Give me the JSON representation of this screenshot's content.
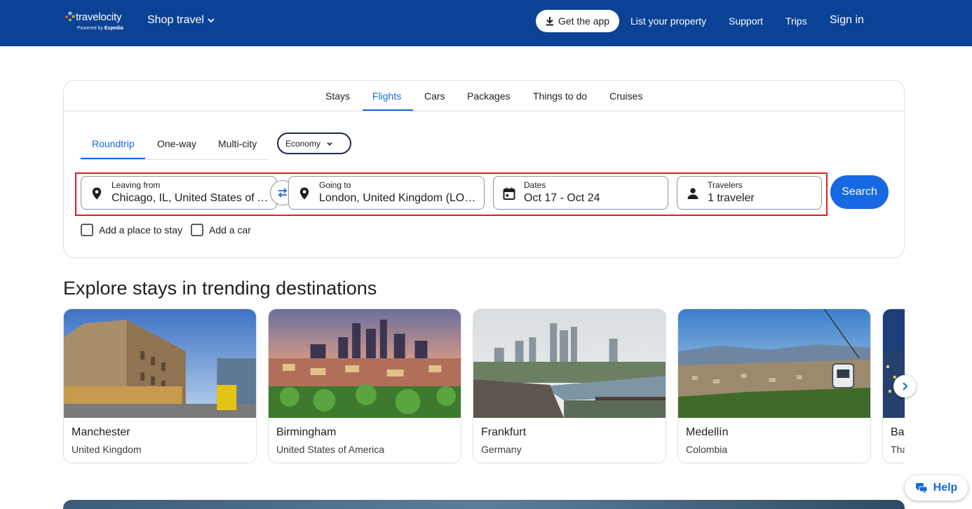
{
  "header": {
    "logo_main": "travelocity",
    "logo_sub_prefix": "Powered by",
    "logo_sub_brand": "Expedia",
    "shop_travel": "Shop travel",
    "get_app": "Get the app",
    "list_property": "List your property",
    "support": "Support",
    "trips": "Trips",
    "sign_in": "Sign in"
  },
  "search": {
    "tabs": [
      {
        "label": "Stays"
      },
      {
        "label": "Flights",
        "active": true
      },
      {
        "label": "Cars"
      },
      {
        "label": "Packages"
      },
      {
        "label": "Things to do"
      },
      {
        "label": "Cruises"
      }
    ],
    "trip_types": [
      {
        "label": "Roundtrip",
        "active": true
      },
      {
        "label": "One-way"
      },
      {
        "label": "Multi-city"
      }
    ],
    "cabin_class": "Economy",
    "leaving_from": {
      "label": "Leaving from",
      "value": "Chicago, IL, United States of America (CHI-All Airports)"
    },
    "going_to": {
      "label": "Going to",
      "value": "London, United Kingdom (LON-All Airports)"
    },
    "dates": {
      "label": "Dates",
      "value": "Oct 17 - Oct 24"
    },
    "travelers": {
      "label": "Travelers",
      "value": "1 traveler"
    },
    "search_button": "Search",
    "add_stay": "Add a place to stay",
    "add_car": "Add a car"
  },
  "explore": {
    "title": "Explore stays in trending destinations",
    "cards": [
      {
        "name": "Manchester",
        "country": "United Kingdom"
      },
      {
        "name": "Birmingham",
        "country": "United States of America"
      },
      {
        "name": "Frankfurt",
        "country": "Germany"
      },
      {
        "name": "Medellín",
        "country": "Colombia"
      },
      {
        "name": "Ba",
        "country": "Tha"
      }
    ]
  },
  "help": "Help",
  "colors": {
    "header_bg": "#0b4296",
    "accent": "#1668e3",
    "highlight": "#e01e1e"
  }
}
